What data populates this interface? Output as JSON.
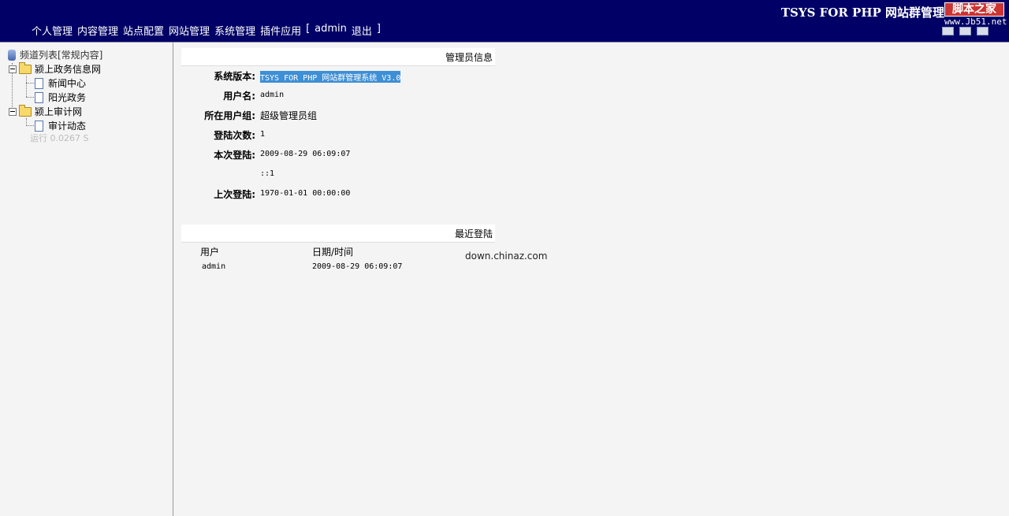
{
  "header": {
    "app_title": "TSYS FOR PHP 网站群管理",
    "watermark_brand": "脚本之家",
    "watermark_url": "www.Jb51.net",
    "nav": [
      "个人管理",
      "内容管理",
      "站点配置",
      "网站管理",
      "系统管理",
      "插件应用"
    ],
    "bracket_open": "[",
    "user": "admin",
    "logout": "退出",
    "bracket_close": "]"
  },
  "sidebar": {
    "root": "频道列表[常规内容]",
    "groups": [
      {
        "label": "颍上政务信息网",
        "children": [
          "新闻中心",
          "阳光政务"
        ]
      },
      {
        "label": "颍上审计网",
        "children": [
          "审计动态"
        ]
      }
    ],
    "runtime": "运行 0.0267 S"
  },
  "admin_info": {
    "section_title": "管理员信息",
    "rows": [
      {
        "label": "系统版本:",
        "value": "TSYS FOR PHP 网站群管理系统 V3.0"
      },
      {
        "label": "用户名:",
        "value": "admin"
      },
      {
        "label": "所在用户组:",
        "value": "超级管理员组"
      },
      {
        "label": "登陆次数:",
        "value": "1"
      },
      {
        "label": "本次登陆:",
        "value": "2009-08-29 06:09:07"
      },
      {
        "label": "",
        "value": "::1"
      },
      {
        "label": "上次登陆:",
        "value": "1970-01-01 00:00:00"
      }
    ]
  },
  "recent_login": {
    "section_title": "最近登陆",
    "columns": [
      "用户",
      "日期/时间"
    ],
    "rows": [
      [
        "admin",
        "2009-08-29 06:09:07"
      ]
    ]
  },
  "site_mark": "down.chinaz.com"
}
